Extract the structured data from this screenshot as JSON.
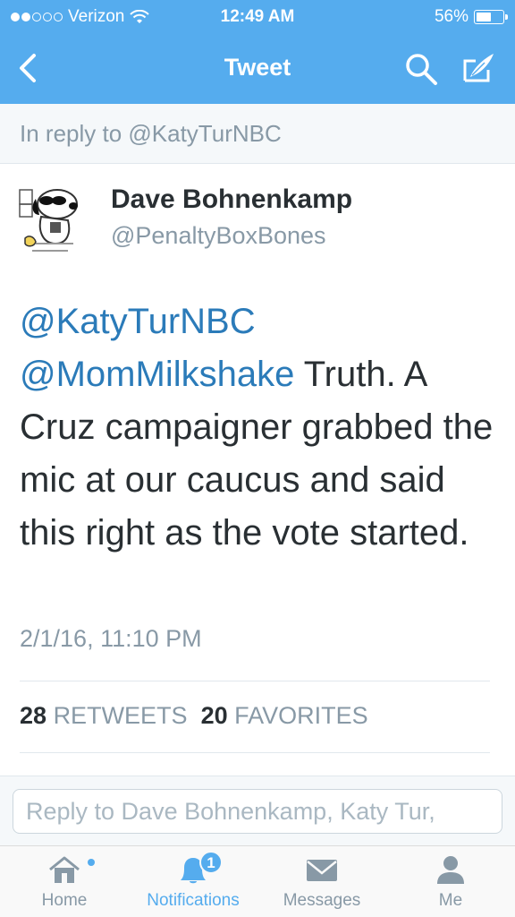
{
  "status_bar": {
    "carrier": "Verizon",
    "time": "12:49 AM",
    "battery_percent": "56%",
    "battery_level": 0.56
  },
  "nav": {
    "title": "Tweet",
    "back_icon": "chevron-left-icon",
    "search_icon": "search-icon",
    "compose_icon": "compose-icon"
  },
  "reply_context": "In reply to @KatyTurNBC",
  "tweet": {
    "author_name": "Dave Bohnenkamp",
    "author_handle": "@PenaltyBoxBones",
    "mention_1": "@KatyTurNBC",
    "mention_2": "@MomMilkshake",
    "body": " Truth. A Cruz campaigner grabbed the mic at our caucus and said this right as the vote started.",
    "timestamp": "2/1/16, 11:10 PM",
    "retweets_count": "28",
    "retweets_label": "RETWEETS",
    "favorites_count": "20",
    "favorites_label": "FAVORITES"
  },
  "reply_box": {
    "placeholder": "Reply to Dave Bohnenkamp, Katy Tur, "
  },
  "tabs": [
    {
      "label": "Home",
      "icon": "home-icon"
    },
    {
      "label": "Notifications",
      "icon": "bell-icon",
      "badge": "1"
    },
    {
      "label": "Messages",
      "icon": "envelope-icon"
    },
    {
      "label": "Me",
      "icon": "person-icon"
    }
  ],
  "colors": {
    "brand": "#55acee",
    "link": "#2b7bb9",
    "muted": "#8899a6",
    "text": "#292f33"
  }
}
